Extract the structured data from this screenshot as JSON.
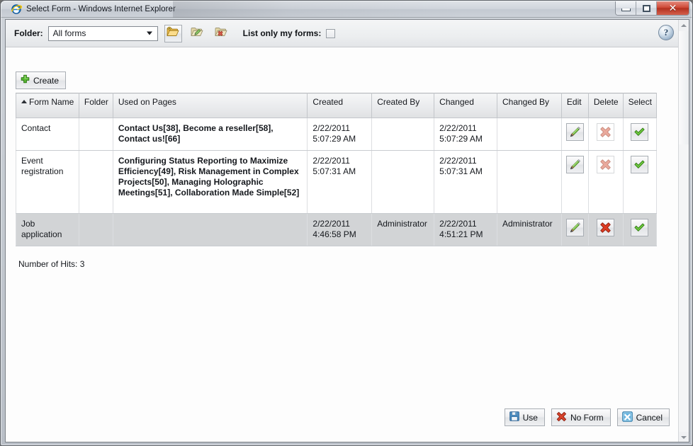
{
  "window": {
    "title": "Select Form - Windows Internet Explorer",
    "app_icon": "internet-explorer-icon",
    "ghost_text": "",
    "controls": {
      "minimize": "minimize-button",
      "maximize": "maximize-button",
      "close": "close-button",
      "close_glyph": "✕"
    }
  },
  "toolbar": {
    "folder_label": "Folder:",
    "folder_value": "All forms",
    "folder_options": [
      "All forms"
    ],
    "new_folder_icon": "new-folder-icon",
    "edit_folder_icon": "edit-folder-icon",
    "delete_folder_icon": "delete-folder-icon",
    "list_only_label": "List only my forms:",
    "list_only_checked": false,
    "help_glyph": "?"
  },
  "actions": {
    "create_label": "Create",
    "create_icon": "plus-icon"
  },
  "table": {
    "columns": [
      {
        "label": "Form Name",
        "sorted": true,
        "sort_dir": "asc"
      },
      {
        "label": "Folder",
        "sorted": false
      },
      {
        "label": "Used on Pages",
        "sorted": false
      },
      {
        "label": "Created",
        "sorted": false
      },
      {
        "label": "Created By",
        "sorted": false
      },
      {
        "label": "Changed",
        "sorted": false
      },
      {
        "label": "Changed By",
        "sorted": false
      },
      {
        "label": "Edit",
        "sorted": false
      },
      {
        "label": "Delete",
        "sorted": false
      },
      {
        "label": "Select",
        "sorted": false
      }
    ],
    "rows": [
      {
        "form_name": "Contact",
        "folder": "",
        "used_on_pages": "Contact Us[38], Become a reseller[58], Contact us![66]",
        "created_date": "2/22/2011",
        "created_time": "5:07:29 AM",
        "created_by": "",
        "changed_date": "2/22/2011",
        "changed_time": "5:07:29 AM",
        "changed_by": "",
        "edit_icon": "pencil-icon",
        "delete_icon": "delete-x-icon",
        "select_icon": "checkmark-icon",
        "delete_enabled": false,
        "highlighted": false
      },
      {
        "form_name": "Event registration",
        "folder": "",
        "used_on_pages": "Configuring Status Reporting to Maximize Efficiency[49], Risk Management in Complex Projects[50], Managing Holographic Meetings[51], Collaboration Made Simple[52]",
        "created_date": "2/22/2011",
        "created_time": "5:07:31 AM",
        "created_by": "",
        "changed_date": "2/22/2011",
        "changed_time": "5:07:31 AM",
        "changed_by": "",
        "edit_icon": "pencil-icon",
        "delete_icon": "delete-x-icon",
        "select_icon": "checkmark-icon",
        "delete_enabled": false,
        "highlighted": false
      },
      {
        "form_name": "Job application",
        "folder": "",
        "used_on_pages": "",
        "created_date": "2/22/2011",
        "created_time": "4:46:58 PM",
        "created_by": "Administrator",
        "changed_date": "2/22/2011",
        "changed_time": "4:51:21 PM",
        "changed_by": "Administrator",
        "edit_icon": "pencil-icon",
        "delete_icon": "delete-x-icon",
        "select_icon": "checkmark-icon",
        "delete_enabled": true,
        "highlighted": true
      }
    ]
  },
  "status": {
    "hits_text": "Number of Hits: 3"
  },
  "footer": {
    "use_label": "Use",
    "use_icon": "save-floppy-icon",
    "no_form_label": "No Form",
    "no_form_icon": "red-x-icon",
    "cancel_label": "Cancel",
    "cancel_icon": "blue-x-icon"
  },
  "colors": {
    "accent_green": "#5cb030",
    "accent_red": "#d43a26",
    "accent_blue": "#3f87c4",
    "row_highlight": "#d2d4d6",
    "close_button": "#c0392b"
  }
}
